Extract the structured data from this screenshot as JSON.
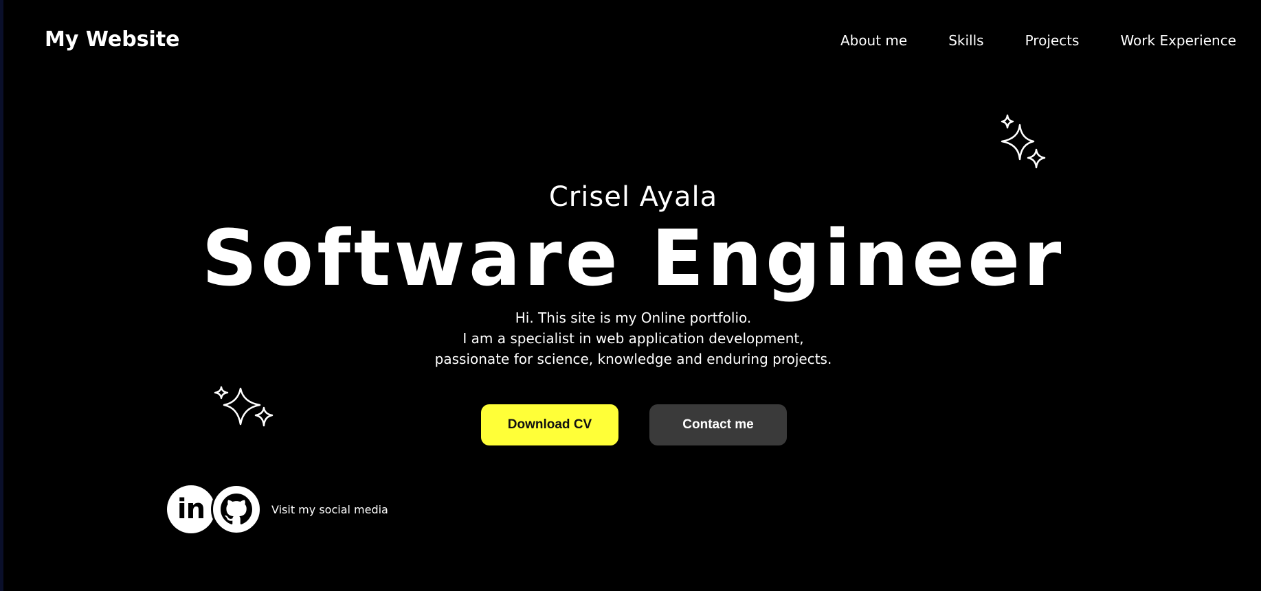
{
  "header": {
    "logo": "My Website",
    "nav": [
      {
        "label": "About me"
      },
      {
        "label": "Skills"
      },
      {
        "label": "Projects"
      },
      {
        "label": "Work Experience"
      }
    ]
  },
  "hero": {
    "name": "Crisel Ayala",
    "title": "Software Engineer",
    "description": [
      "Hi. This site is my Online portfolio.",
      "I am a specialist in web application development,",
      "passionate for science, knowledge and enduring projects."
    ],
    "buttons": {
      "download": "Download CV",
      "contact": "Contact me"
    }
  },
  "social": {
    "linkedin_glyph": "in",
    "text": "Visit my social media"
  },
  "icons": {
    "sparkle_top": "sparkles-icon",
    "sparkle_left": "sparkles-icon",
    "linkedin": "linkedin-icon",
    "github": "github-icon"
  },
  "colors": {
    "background": "#000000",
    "accent": "#ffff38",
    "secondary_button": "#3a3a3a",
    "text": "#ffffff"
  }
}
